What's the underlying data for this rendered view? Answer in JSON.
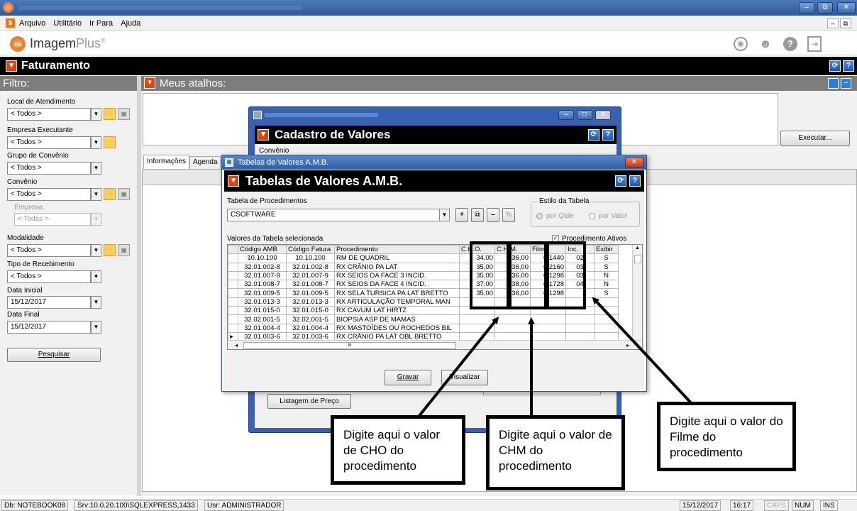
{
  "window": {
    "title_blurred": "Imagem Plus - Faturamento - NOTEBOOK08 - ADMINISTRADOR",
    "controls": [
      "–",
      "⧉",
      "✕"
    ]
  },
  "menu": {
    "items": [
      "Arquivo",
      "Utilitário",
      "Ir Para",
      "Ajuda"
    ]
  },
  "app": {
    "logo_a": "Imagem",
    "logo_b": "Plus",
    "logo_mark": "®"
  },
  "module": {
    "title": "Faturamento"
  },
  "filter": {
    "header": "Filtro:",
    "local_label": "Local de Atendimento",
    "local_value": "< Todos >",
    "empresa_label": "Empresa Executante",
    "empresa_value": "< Todos >",
    "grupo_label": "Grupo de Convênio",
    "grupo_value": "< Todos >",
    "convenio_label": "Convênio",
    "convenio_value": "< Todos >",
    "empresa2_label": "Empresa",
    "empresa2_value": "< Todas >",
    "modalidade_label": "Modalidade",
    "modalidade_value": "< Todos >",
    "tipo_label": "Tipo de Recebimento",
    "tipo_value": "< Todos >",
    "data_ini_label": "Data Inicial",
    "data_ini_value": "15/12/2017",
    "data_fim_label": "Data Final",
    "data_fim_value": "15/12/2017",
    "search_button": "Pesquisar"
  },
  "shortcuts": {
    "header": "Meus atalhos:",
    "execute_button": "Executar..."
  },
  "tabs": {
    "info": "Informações",
    "agenda": "Agenda"
  },
  "cadastro": {
    "title": "Cadastro de Valores",
    "subtitle_cut": "Convênio",
    "listagem_button": "Listagem de Preço"
  },
  "dialog": {
    "window_title": "Tabelas de Valores A.M.B.",
    "header": "Tabelas de Valores A.M.B.",
    "table_label": "Tabela de Procedimentos",
    "table_value": "CSOFTWARE",
    "tool_buttons": [
      "+",
      "⧉",
      "–",
      "%"
    ],
    "style_group": "Estilo da Tabela",
    "style_qtd": "por Qtde",
    "style_valor": "por Valor",
    "values_label": "Valores da Tabela selecionada",
    "active_label": "Procedimento Ativos",
    "columns": [
      "Código AMB",
      "Código Fatura",
      "Procedimento",
      "C.H.O.",
      "C.H.M.",
      "Filme",
      "Inc.",
      "Exibir"
    ],
    "rows": [
      [
        "10.10.100",
        "10.10.100",
        "RM DE QUADRIL",
        "34,00",
        "36,00",
        "0,1440",
        "02",
        "S"
      ],
      [
        "32.01.002-8",
        "32.01.002-8",
        "RX CRÂNIO PA LAT",
        "35,00",
        "36,00",
        "0,2160",
        "03",
        "S"
      ],
      [
        "32.01.007-9",
        "32.01.007-9",
        "RX SEIOS DA FACE 3 INCID.",
        "35,00",
        "36,00",
        "0,1298",
        "03",
        "N"
      ],
      [
        "32.01.008-7",
        "32.01.008-7",
        "RX SEIOS DA FACE 4 INCID.",
        "37,00",
        "38,00",
        "0,1728",
        "04",
        "N"
      ],
      [
        "32.01.009-5",
        "32.01.009-5",
        "RX SELA TURSICA PA LAT BRETTO",
        "35,00",
        "36,00",
        "0,1298",
        "",
        "S"
      ],
      [
        "32.01.013-3",
        "32.01.013-3",
        "RX ARTICULAÇÃO TEMPORAL MAN",
        "",
        "",
        "",
        "",
        ""
      ],
      [
        "32.01.015-0",
        "32.01.015-0",
        "RX CAVUM LAT HIRTZ",
        "",
        "",
        "",
        "",
        ""
      ],
      [
        "32.02.001-5",
        "32.02.001-5",
        "BIOPSIA ASP DE MAMAS",
        "",
        "",
        "",
        "",
        ""
      ],
      [
        "32.01.004-4",
        "32.01.004-4",
        "RX MASTOÍDES OU ROCHEDOS BIL",
        "",
        "",
        "",
        "",
        ""
      ],
      [
        "32.01.003-6",
        "32.01.003-6",
        "RX CRÂNIO PA LAT OBL BRETTO",
        "",
        "",
        "",
        "",
        ""
      ]
    ],
    "save_button": "Gravar",
    "view_button": "Visualizar"
  },
  "callouts": {
    "cho": "Digite aqui o valor de CHO do procedimento",
    "chm": "Digite aqui o valor de CHM do procedimento",
    "filme": "Digite aqui o valor do Filme do procedimento"
  },
  "status": {
    "db": "Db: NOTEBOOK08",
    "srv": "Srv:10.0.20.100\\SQLEXPRESS,1433",
    "usr": "Usr: ADMINISTRADOR",
    "date": "15/12/2017",
    "time": "16:17",
    "caps": "CAPS",
    "num": "NUM",
    "ins": "INS"
  },
  "colors": {
    "accent_red": "#d9480f",
    "title_blue": "#2d5a9c",
    "header_gray": "#7d7d7d"
  }
}
